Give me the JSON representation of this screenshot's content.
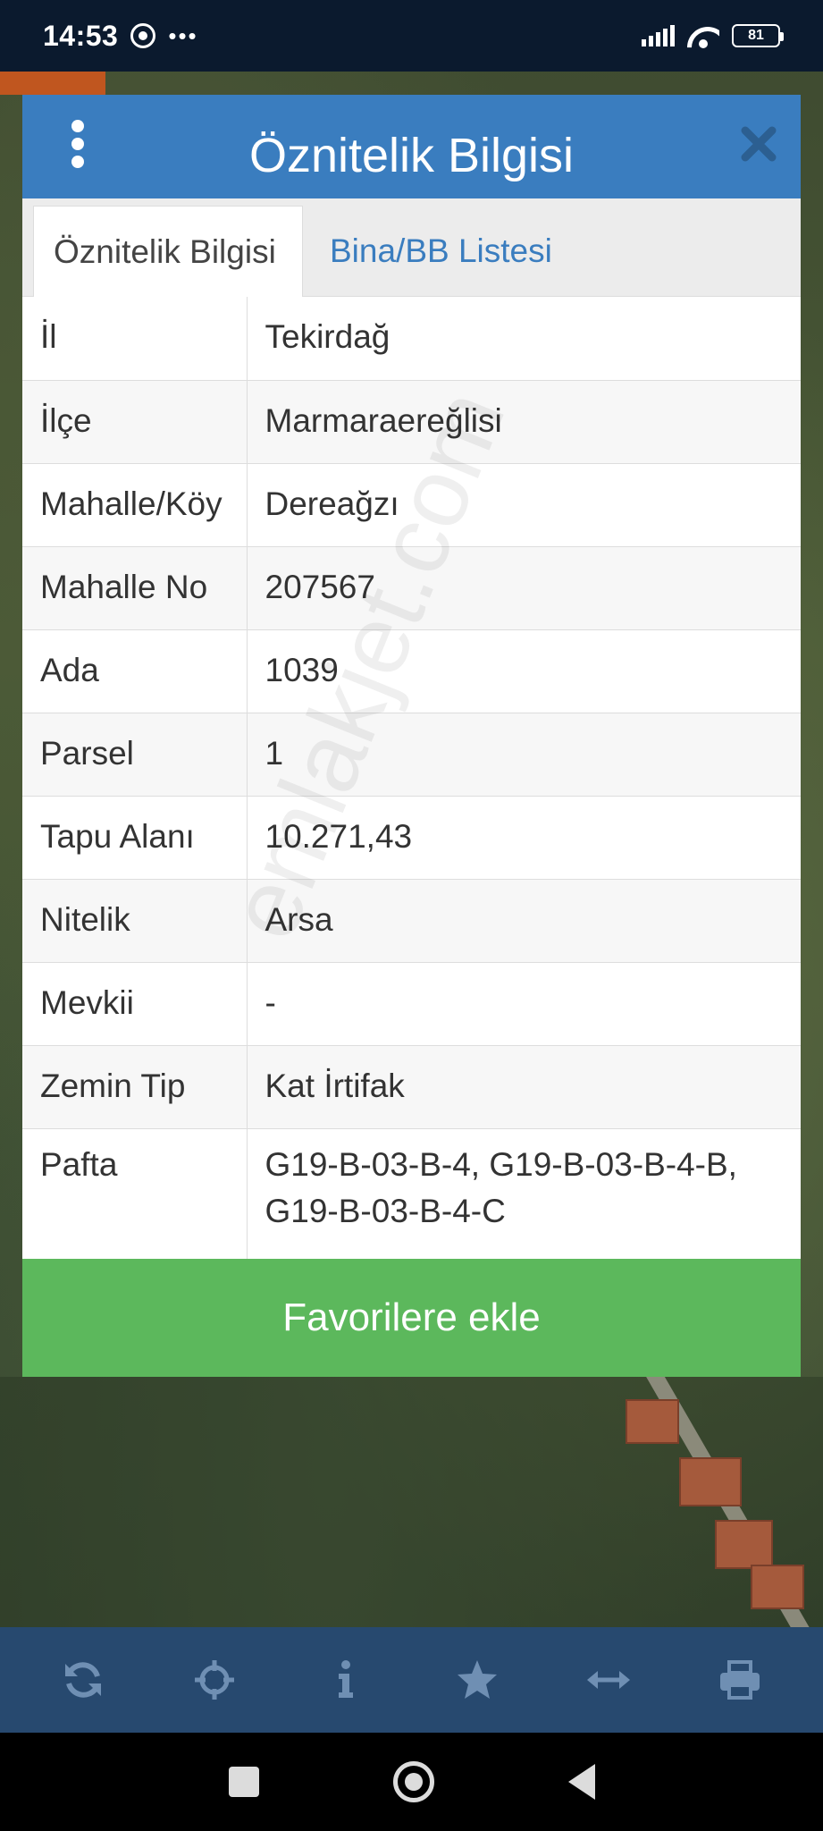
{
  "status_bar": {
    "time": "14:53",
    "dots": "•••",
    "battery": "81"
  },
  "dialog": {
    "title": "Öznitelik Bilgisi",
    "tabs": [
      {
        "label": "Öznitelik Bilgisi",
        "active": true
      },
      {
        "label": "Bina/BB Listesi",
        "active": false
      }
    ],
    "rows": [
      {
        "key": "İl",
        "value": "Tekirdağ"
      },
      {
        "key": "İlçe",
        "value": "Marmaraereğlisi"
      },
      {
        "key": "Mahalle/Köy",
        "value": "Dereağzı"
      },
      {
        "key": "Mahalle No",
        "value": "207567"
      },
      {
        "key": "Ada",
        "value": "1039"
      },
      {
        "key": "Parsel",
        "value": "1"
      },
      {
        "key": "Tapu Alanı",
        "value": "10.271,43"
      },
      {
        "key": "Nitelik",
        "value": "Arsa"
      },
      {
        "key": "Mevkii",
        "value": "-"
      },
      {
        "key": "Zemin Tip",
        "value": "Kat İrtifak"
      },
      {
        "key": "Pafta",
        "value": "G19-B-03-B-4, G19-B-03-B-4-B, G19-B-03-B-4-C"
      }
    ],
    "favorite_button": "Favorilere ekle"
  },
  "watermark": "emlakjet.com",
  "toolbar": {
    "icons": [
      "refresh-icon",
      "crosshair-icon",
      "info-icon",
      "star-icon",
      "measure-icon",
      "print-icon"
    ]
  },
  "colors": {
    "header": "#3a7dbf",
    "button": "#5cb85c",
    "toolbar": "#27496f",
    "status_bar": "#0b1a2e"
  }
}
